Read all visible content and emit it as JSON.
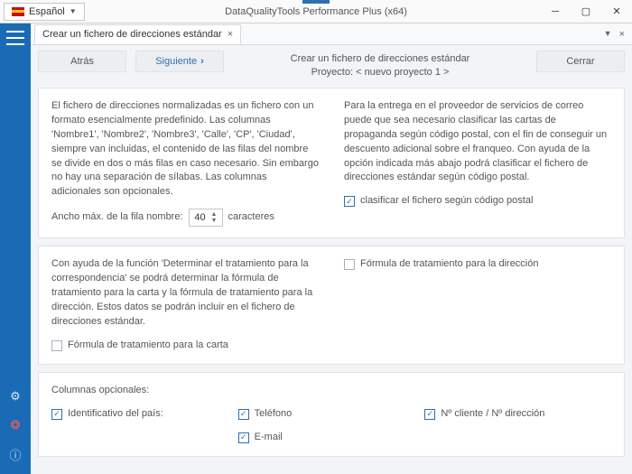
{
  "titlebar": {
    "language": "Español",
    "title": "DataQualityTools Performance Plus (x64)"
  },
  "tab": {
    "label": "Crear un fichero de direcciones estándar"
  },
  "nav": {
    "back": "Atrás",
    "next": "Siguiente",
    "close": "Cerrar"
  },
  "header": {
    "title": "Crear un fichero de direcciones estándar",
    "project": "Proyecto: < nuevo proyecto 1 >"
  },
  "panel1": {
    "left": "El fichero de direcciones normalizadas es un fichero con un formato esencialmente predefinido. Las columnas 'Nombre1', 'Nombre2', 'Nombre3', 'Calle', 'CP', 'Ciudad', siempre van incluidas, el contenido de las filas del nombre se divide en dos o más filas en caso necesario. Sin embargo no hay una separación de sílabas. Las columnas adicionales son opcionales.",
    "right": "Para la entrega en el proveedor de servicios de correo puede que sea necesario clasificar las cartas de propaganda según código postal, con el fin de conseguir un descuento adicional sobre el franqueo. Con ayuda de la opción indicada más abajo podrá clasificar el fichero de direcciones estándar según código postal.",
    "widthLabel": "Ancho máx. de la fila nombre:",
    "widthValue": "40",
    "widthUnit": "caracteres",
    "sortByZip": "clasificar el fichero según código postal"
  },
  "panel2": {
    "left": "Con ayuda de la función 'Determinar el tratamiento para la correspondencia' se podrá determinar la fórmula de tratamiento para la carta y la fórmula de tratamiento para la dirección. Estos datos se podrán incluir en el fichero de direcciones estándar.",
    "checkLetter": "Fórmula de tratamiento para la carta",
    "checkAddress": "Fórmula de tratamiento para la dirección"
  },
  "panel3": {
    "title": "Columnas opcionales:",
    "country": "Identificativo del país:",
    "phone": "Teléfono",
    "email": "E-mail",
    "client": "Nº cliente / Nº dirección"
  }
}
